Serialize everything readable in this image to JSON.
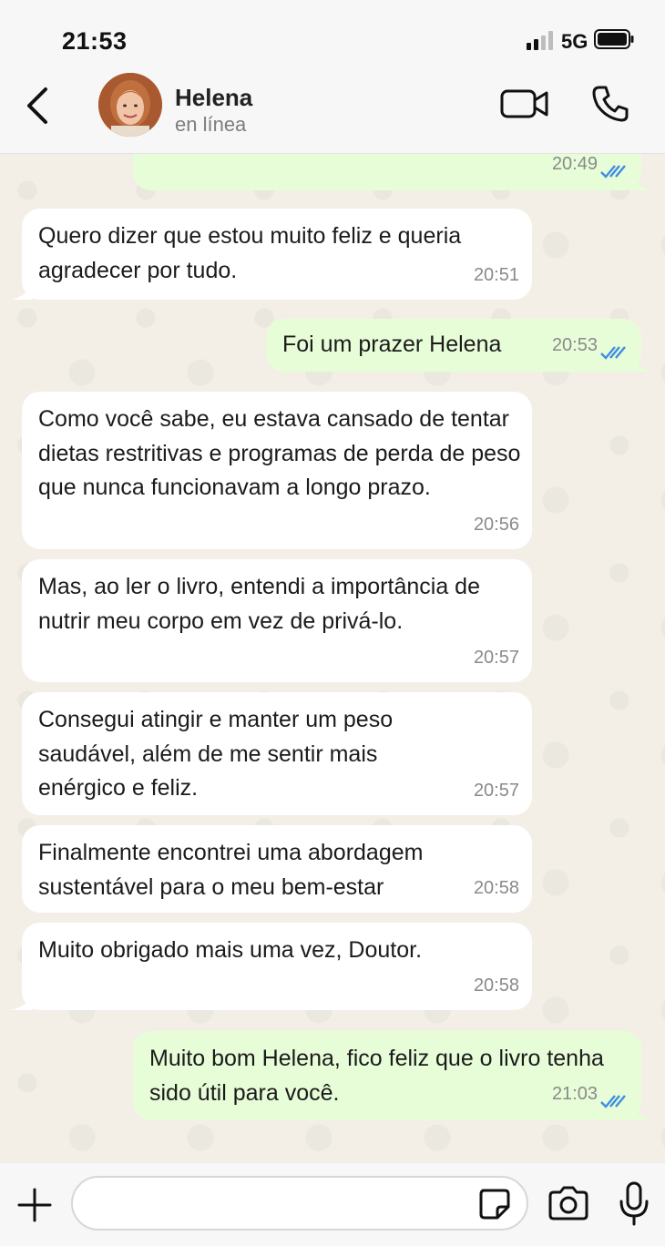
{
  "status_bar": {
    "time": "21:53",
    "network": "5G"
  },
  "header": {
    "contact_name": "Helena",
    "contact_status": "en línea"
  },
  "messages": [
    {
      "dir": "out",
      "text": "",
      "time": "20:49",
      "read": true
    },
    {
      "dir": "in",
      "text": "Quero dizer que estou muito feliz e queria agradecer por tudo.",
      "time": "20:51"
    },
    {
      "dir": "out",
      "text": "Foi um prazer Helena",
      "time": "20:53",
      "read": true
    },
    {
      "dir": "in",
      "text": "Como você sabe, eu estava cansado de tentar dietas restritivas e programas de perda de peso que nunca funcionavam a longo prazo.",
      "time": "20:56"
    },
    {
      "dir": "in",
      "text": "Mas, ao ler o livro, entendi a importância de nutrir meu corpo em vez de privá-lo.",
      "time": "20:57"
    },
    {
      "dir": "in",
      "text": "Consegui atingir e manter um peso saudável, além de me sentir mais enérgico e feliz.",
      "time": "20:57"
    },
    {
      "dir": "in",
      "text": "Finalmente encontrei uma abordagem sustentável para o meu bem-estar",
      "time": "20:58"
    },
    {
      "dir": "in",
      "text": "Muito obrigado mais uma vez, Doutor.",
      "time": "20:58"
    },
    {
      "dir": "out",
      "text": "Muito bom Helena, fico feliz que o livro tenha sido útil para você.",
      "time": "21:03",
      "read": true
    }
  ],
  "colors": {
    "outgoing_bubble": "#e7fdd8",
    "incoming_bubble": "#ffffff",
    "read_ticks": "#3f8de0",
    "chat_bg": "#f3efe6"
  },
  "icons": [
    "back-arrow-icon",
    "video-call-icon",
    "phone-icon",
    "plus-icon",
    "sticker-icon",
    "camera-icon",
    "microphone-icon",
    "double-check-icon"
  ]
}
